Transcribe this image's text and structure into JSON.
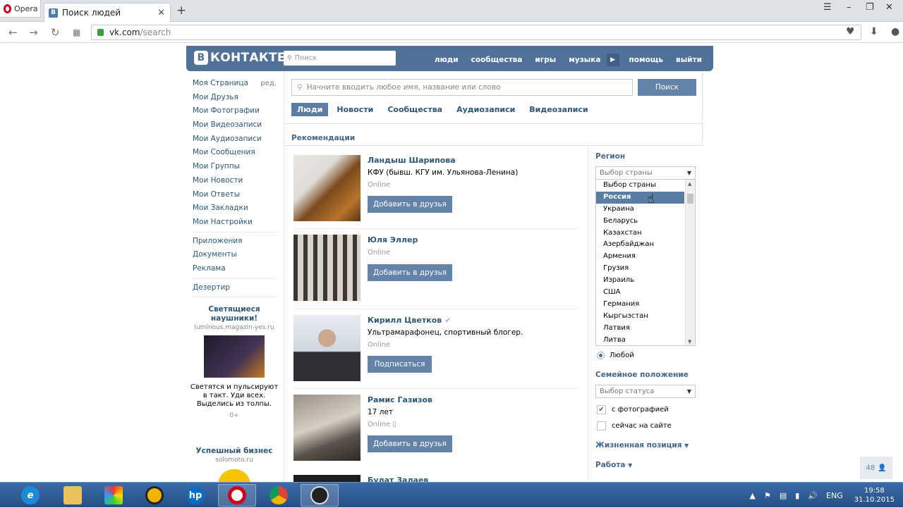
{
  "browser": {
    "menu_label": "Opera",
    "tab_title": "Поиск людей",
    "tab_favicon": "B",
    "url_host": "vk.com",
    "url_path": "/search"
  },
  "vk": {
    "logo": "КОНТАКТЕ",
    "logo_letter": "В",
    "search_placeholder": "Поиск",
    "nav": [
      "люди",
      "сообщества",
      "игры",
      "музыка",
      "помощь",
      "выйти"
    ]
  },
  "menu": {
    "edit_label": "ред.",
    "items": [
      "Моя Страница",
      "Мои Друзья",
      "Мои Фотографии",
      "Мои Видеозаписи",
      "Мои Аудиозаписи",
      "Мои Сообщения",
      "Мои Группы",
      "Мои Новости",
      "Мои Ответы",
      "Мои Закладки",
      "Мои Настройки"
    ],
    "items2": [
      "Приложения",
      "Документы",
      "Реклама"
    ],
    "items3": [
      "Дезертир"
    ]
  },
  "ads": [
    {
      "title": "Светящиеся наушники!",
      "url": "luminous.magazin-yes.ru",
      "desc": "Светятся и пульсируют в такт. Уди всех. Выделись из толпы.",
      "count": "0+"
    },
    {
      "title": "Успешный бизнес",
      "url": "solomoto.ru"
    }
  ],
  "search": {
    "placeholder": "Начните вводить любое имя, название или слово",
    "button": "Поиск",
    "tabs": [
      "Люди",
      "Новости",
      "Сообщества",
      "Аудиозаписи",
      "Видеозаписи"
    ],
    "section": "Рекомендации"
  },
  "people": [
    {
      "name": "Ландыш Шарипова",
      "line2": "КФУ (бывш. КГУ им. Ульянова-Ленина)",
      "status": "Online",
      "button": "Добавить в друзья",
      "verified": false
    },
    {
      "name": "Юля Эллер",
      "line2": "",
      "status": "Online",
      "button": "Добавить в друзья",
      "verified": false
    },
    {
      "name": "Кирилл Цветков",
      "line2": "Ультрамарафонец, спортивный блогер.",
      "status": "Online",
      "button": "Подписаться",
      "verified": true
    },
    {
      "name": "Рамис Газизов",
      "line2": "17 лет",
      "status": "Online",
      "button": "Добавить в друзья",
      "verified": false
    },
    {
      "name": "Булат Залаев",
      "line2": "",
      "status": "",
      "button": "",
      "verified": false
    }
  ],
  "filter": {
    "region_label": "Регион",
    "country_placeholder": "Выбор страны",
    "countries": [
      "Выбор страны",
      "Россия",
      "Украина",
      "Беларусь",
      "Казахстан",
      "Азербайджан",
      "Армения",
      "Грузия",
      "Израиль",
      "США",
      "Германия",
      "Кыргызстан",
      "Латвия",
      "Литва"
    ],
    "highlighted_index": 1,
    "any_label": "Любой",
    "family_label": "Семейное положение",
    "status_placeholder": "Выбор статуса",
    "with_photo": "с фотографией",
    "with_photo_checked": true,
    "online_now": "сейчас на сайте",
    "online_checked": false,
    "life_position": "Жизненная позиция",
    "work": "Работа"
  },
  "badge": "48",
  "taskbar": {
    "lang": "ENG",
    "time": "19:58",
    "date": "31.10.2015"
  }
}
